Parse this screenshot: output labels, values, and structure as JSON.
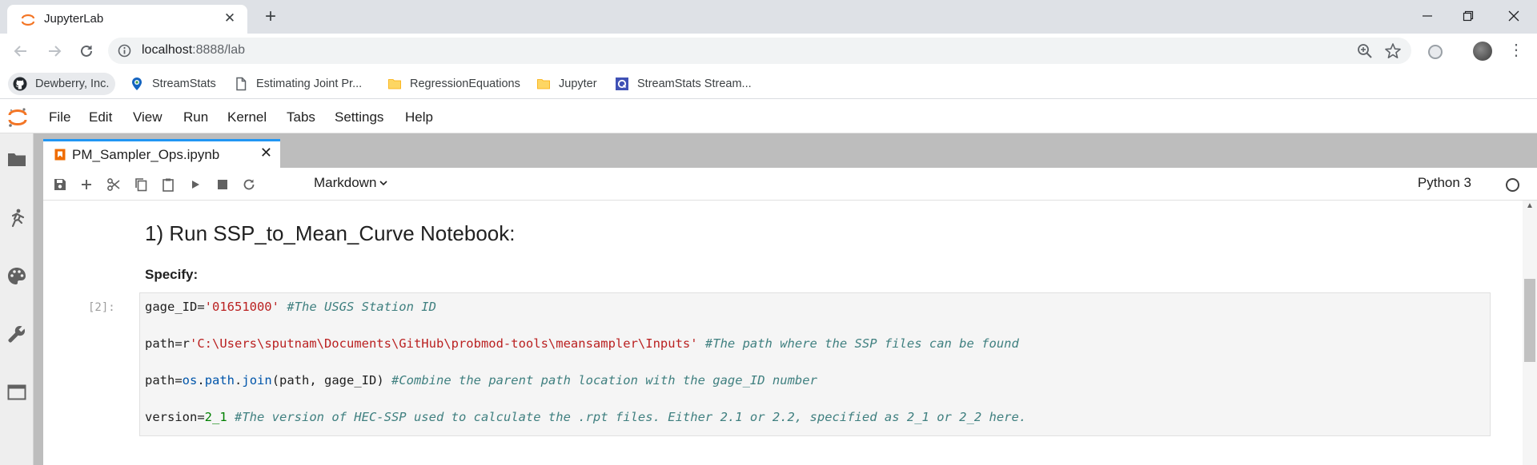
{
  "browser": {
    "tab_title": "JupyterLab",
    "tab_close": "✕",
    "new_tab": "+",
    "url_host": "localhost",
    "url_rest": ":8888/lab"
  },
  "bookmarks": [
    {
      "label": "Dewberry, Inc.",
      "icon": "github-icon"
    },
    {
      "label": "StreamStats",
      "icon": "map-pin-icon"
    },
    {
      "label": "Estimating Joint Pr...",
      "icon": "page-icon"
    },
    {
      "label": "RegressionEquations",
      "icon": "folder-icon"
    },
    {
      "label": "Jupyter",
      "icon": "folder-icon"
    },
    {
      "label": "StreamStats Stream...",
      "icon": "q-icon"
    }
  ],
  "menubar": [
    "File",
    "Edit",
    "View",
    "Run",
    "Kernel",
    "Tabs",
    "Settings",
    "Help"
  ],
  "document_tab": {
    "title": "PM_Sampler_Ops.ipynb",
    "close": "✕"
  },
  "notebook_toolbar": {
    "cell_type": "Markdown",
    "kernel": "Python 3"
  },
  "notebook": {
    "heading": "1) Run SSP_to_Mean_Curve Notebook:",
    "specify": "Specify:",
    "prompt": "[2]:",
    "code": {
      "line1": {
        "a": "gage_ID=",
        "b": "'01651000'",
        "c": " ",
        "d": "#The USGS Station ID"
      },
      "line2": {
        "a": "path=r",
        "b": "'C:\\Users\\sputnam\\Documents\\GitHub\\probmod-tools\\meansampler\\Inputs'",
        "c": " ",
        "d": "#The path where the SSP files can be found"
      },
      "line3": {
        "a": "path=",
        "b": "os",
        "c": ".",
        "d": "path",
        "e": ".",
        "f": "join",
        "g": "(path, gage_ID) ",
        "h": "#Combine the parent path location with the gage_ID number"
      },
      "line4": {
        "a": "version=",
        "b": "2_1",
        "c": " ",
        "d": "#The version of HEC-SSP used to calculate the .rpt files. Either 2.1 or 2.2, specified as 2_1 or 2_2 here."
      }
    }
  },
  "colors": {
    "accent_tab": "#2196f3",
    "jupyter_orange": "#f37626",
    "string": "#ba2121",
    "comment": "#408080",
    "number": "#008000"
  }
}
